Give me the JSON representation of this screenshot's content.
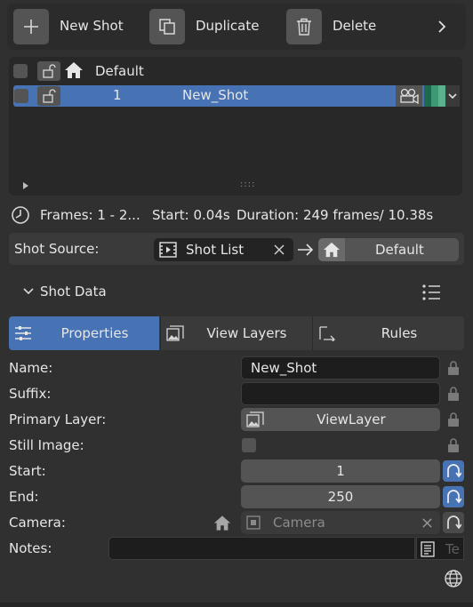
{
  "toolbar": {
    "new_shot": "New Shot",
    "duplicate": "Duplicate",
    "delete": "Delete"
  },
  "shot_list": {
    "rows": [
      {
        "number": "",
        "name": "Default",
        "selected": false
      },
      {
        "number": "1",
        "name": "New_Shot",
        "selected": true
      }
    ],
    "resize_handle": "::::"
  },
  "info": {
    "frames": "Frames: 1 - 2...",
    "start": "Start: 0.04s",
    "duration": "Duration: 249 frames/ 10.38s"
  },
  "source": {
    "label": "Shot Source:",
    "list_value": "Shot List",
    "target_value": "Default"
  },
  "panel": {
    "title": "Shot Data"
  },
  "tabs": [
    {
      "label": "Properties",
      "active": true
    },
    {
      "label": "View Layers",
      "active": false
    },
    {
      "label": "Rules",
      "active": false
    }
  ],
  "props": {
    "name_label": "Name:",
    "name_value": "New_Shot",
    "suffix_label": "Suffix:",
    "suffix_value": "",
    "layer_label": "Primary Layer:",
    "layer_value": "ViewLayer",
    "still_label": "Still Image:",
    "start_label": "Start:",
    "start_value": "1",
    "end_label": "End:",
    "end_value": "250",
    "camera_label": "Camera:",
    "camera_placeholder": "Camera",
    "notes_label": "Notes:",
    "notes_placeholder": "Te"
  },
  "colors": {
    "accent": "#4772b3",
    "background": "#303030",
    "widget": "#545454",
    "text_field": "#1d1d1d"
  }
}
